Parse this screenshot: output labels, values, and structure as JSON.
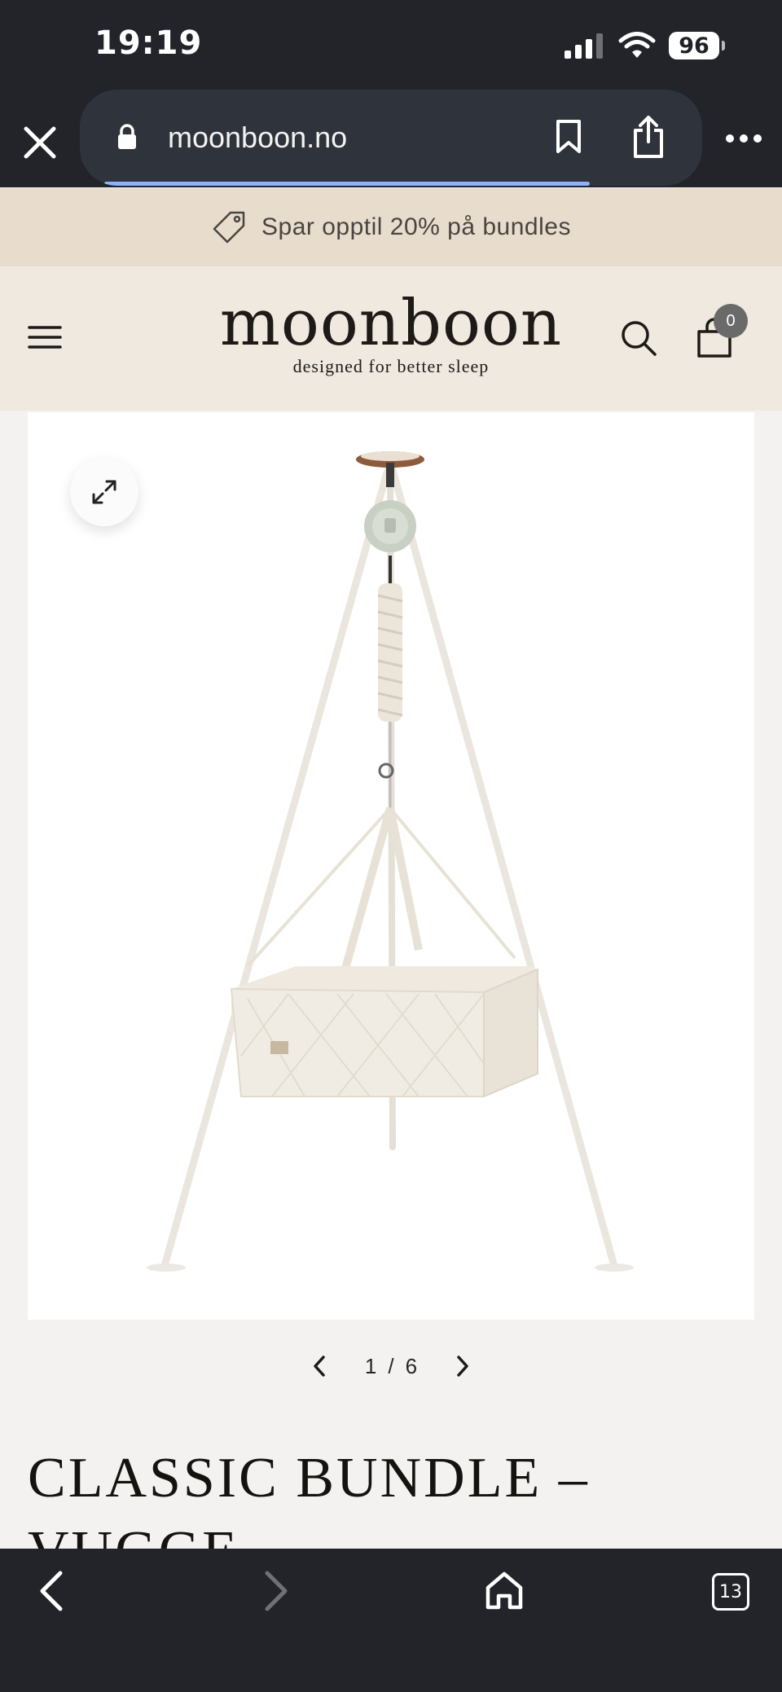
{
  "status_bar": {
    "time": "19:19",
    "battery": "96"
  },
  "browser": {
    "url": "moonboon.no",
    "tabs_count": "13"
  },
  "promo": {
    "text": "Spar opptil 20% på bundles"
  },
  "header": {
    "logo": "moonboon",
    "tagline": "designed for better sleep",
    "cart_count": "0"
  },
  "gallery": {
    "current": "1",
    "separator": "/",
    "total": "6"
  },
  "product": {
    "title_line1": "CLASSIC BUNDLE –",
    "title_line2": "VUGGE"
  },
  "icons": {
    "close": "close-icon",
    "lock": "lock-icon",
    "bookmark": "bookmark-icon",
    "share": "share-icon",
    "more": "more-icon",
    "tag": "tag-icon",
    "menu": "hamburger-menu-icon",
    "search": "search-icon",
    "cart": "shopping-bag-icon",
    "expand": "expand-icon",
    "prev": "chevron-left-icon",
    "next": "chevron-right-icon",
    "back": "back-arrow-icon",
    "forward": "forward-arrow-icon",
    "home": "home-icon"
  },
  "colors": {
    "browser_chrome": "#22242a",
    "promo_bg": "#e8dccd",
    "header_bg": "#efe9e0",
    "page_bg": "#f4f2f0"
  }
}
